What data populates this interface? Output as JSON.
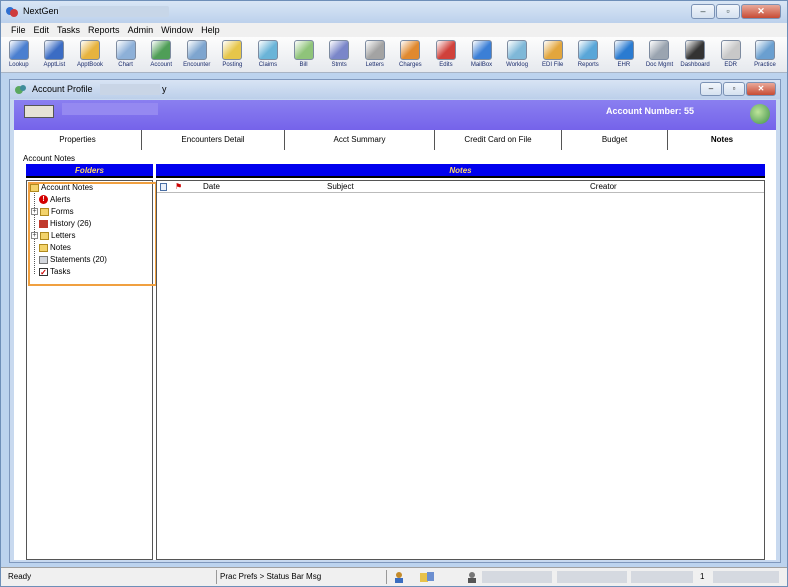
{
  "app": {
    "title": "NextGen - *",
    "window_buttons": {
      "minimize": "–",
      "maximize": "▫",
      "close": "✕"
    }
  },
  "menu": [
    "File",
    "Edit",
    "Tasks",
    "Reports",
    "Admin",
    "Window",
    "Help"
  ],
  "toolbar": [
    {
      "label": "Lookup",
      "icon": "lookup-icon",
      "color": "#4a7fd0"
    },
    {
      "label": "ApptList",
      "icon": "appt-list-icon",
      "color": "#3b6cc4"
    },
    {
      "label": "ApptBook",
      "icon": "appt-book-icon",
      "color": "#e7b33e"
    },
    {
      "label": "Chart",
      "icon": "chart-icon",
      "color": "#8db0d8"
    },
    {
      "label": "Account",
      "icon": "account-icon",
      "color": "#4f9e57"
    },
    {
      "label": "Encounter",
      "icon": "encounter-icon",
      "color": "#7ea5cf"
    },
    {
      "label": "Posting",
      "icon": "posting-icon",
      "color": "#e6c64a"
    },
    {
      "label": "Claims",
      "icon": "claims-icon",
      "color": "#6ab4d8"
    },
    {
      "label": "Bill",
      "icon": "bill-icon",
      "color": "#8fc47a"
    },
    {
      "label": "Stmts",
      "icon": "stmts-icon",
      "color": "#7a86c9"
    },
    {
      "label": "Letters",
      "icon": "letters-icon",
      "color": "#a3a3a3"
    },
    {
      "label": "Charges",
      "icon": "charges-icon",
      "color": "#e0892f"
    },
    {
      "label": "Edits",
      "icon": "edits-icon",
      "color": "#d0413b"
    },
    {
      "label": "MailBox",
      "icon": "mailbox-icon",
      "color": "#3b7fd6"
    },
    {
      "label": "Worklog",
      "icon": "worklog-icon",
      "color": "#7fb8d8"
    },
    {
      "label": "EDI File",
      "icon": "edi-file-icon",
      "color": "#e2a63d"
    },
    {
      "label": "Reports",
      "icon": "reports-icon",
      "color": "#59a6d8"
    },
    {
      "label": "EHR",
      "icon": "ehr-icon",
      "color": "#2a7bd1"
    },
    {
      "label": "Doc Mgmt",
      "icon": "doc-mgmt-icon",
      "color": "#9aa4b0"
    },
    {
      "label": "Dashboard",
      "icon": "dashboard-icon",
      "color": "#333333"
    },
    {
      "label": "EDR",
      "icon": "edr-icon",
      "color": "#c8c8c8"
    },
    {
      "label": "Practice",
      "icon": "practice-icon",
      "color": "#6a9fd0"
    }
  ],
  "child_window": {
    "title": "Account Profile",
    "title_suffix": "y",
    "account_number_label": "Account Number:",
    "account_number": "55"
  },
  "tabs": [
    {
      "label": "Properties",
      "active": false
    },
    {
      "label": "Encounters Detail",
      "active": false
    },
    {
      "label": "Acct Summary",
      "active": false
    },
    {
      "label": "Credit Card on File",
      "active": false
    },
    {
      "label": "Budget",
      "active": false
    },
    {
      "label": "Notes",
      "active": true
    }
  ],
  "notes_section_label": "Account Notes",
  "folders_header": "Folders",
  "notes_header": "Notes",
  "tree": {
    "root": "Account Notes",
    "items": [
      {
        "label": "Alerts",
        "icon": "alert-icon",
        "expander": false
      },
      {
        "label": "Forms",
        "icon": "folder-icon",
        "expander": true
      },
      {
        "label": "History (26)",
        "icon": "history-icon",
        "expander": false
      },
      {
        "label": "Letters",
        "icon": "folder-icon",
        "expander": true
      },
      {
        "label": "Notes",
        "icon": "folder-icon",
        "expander": false
      },
      {
        "label": "Statements (20)",
        "icon": "statements-icon",
        "expander": false
      },
      {
        "label": "Tasks",
        "icon": "tasks-icon",
        "expander": false
      }
    ]
  },
  "grid_columns": [
    "Date",
    "Subject",
    "Creator"
  ],
  "statusbar": {
    "ready": "Ready",
    "message": "Prac Prefs > Status Bar Msg",
    "tail": "1"
  }
}
